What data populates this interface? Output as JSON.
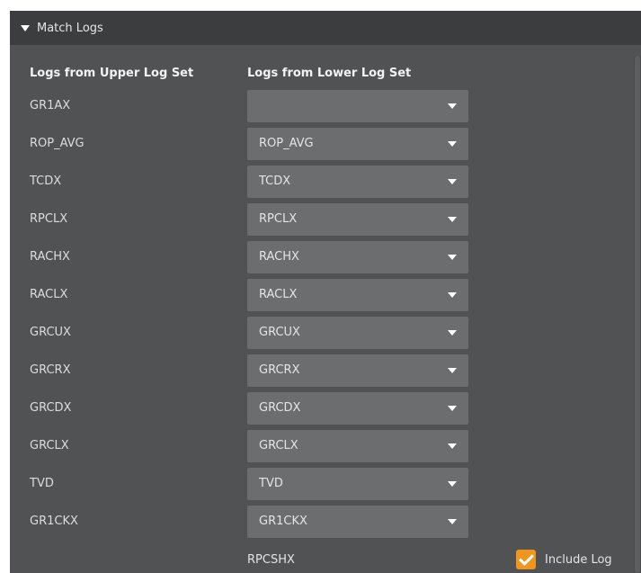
{
  "section": {
    "title": "Match Logs"
  },
  "columns": {
    "upper_header": "Logs from Upper Log Set",
    "lower_header": "Logs from Lower Log Set"
  },
  "rows": [
    {
      "upper": "GR1AX",
      "lower": ""
    },
    {
      "upper": "ROP_AVG",
      "lower": "ROP_AVG"
    },
    {
      "upper": "TCDX",
      "lower": "TCDX"
    },
    {
      "upper": "RPCLX",
      "lower": "RPCLX"
    },
    {
      "upper": "RACHX",
      "lower": "RACHX"
    },
    {
      "upper": "RACLX",
      "lower": "RACLX"
    },
    {
      "upper": "GRCUX",
      "lower": "GRCUX"
    },
    {
      "upper": "GRCRX",
      "lower": "GRCRX"
    },
    {
      "upper": "GRCDX",
      "lower": "GRCDX"
    },
    {
      "upper": "GRCLX",
      "lower": "GRCLX"
    },
    {
      "upper": "TVD",
      "lower": "TVD"
    },
    {
      "upper": "GR1CKX",
      "lower": "GR1CKX"
    }
  ],
  "extra_row": {
    "value": "RPCSHX",
    "include_label": "Include Log",
    "include_checked": true
  },
  "colors": {
    "accent": "#f0961f",
    "panel": "#505254",
    "header": "#3b3d3f",
    "dropdown": "#6b6d6f"
  }
}
